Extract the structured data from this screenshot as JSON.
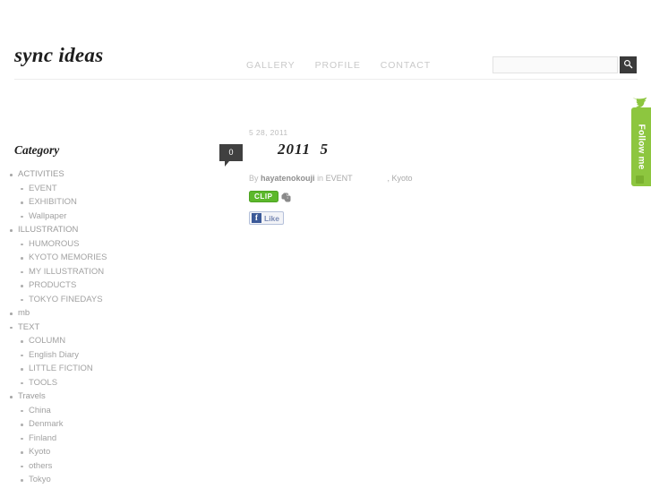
{
  "site": {
    "logo": "sync ideas"
  },
  "nav": {
    "items": [
      {
        "label": "GALLERY"
      },
      {
        "label": "PROFILE"
      },
      {
        "label": "CONTACT"
      }
    ]
  },
  "search": {
    "value": "",
    "placeholder": "",
    "icon": "search-icon"
  },
  "sidebar": {
    "title": "Category",
    "items": [
      {
        "label": "ACTIVITIES",
        "children": [
          {
            "label": "EVENT"
          },
          {
            "label": "EXHIBITION"
          },
          {
            "label": "Wallpaper"
          }
        ]
      },
      {
        "label": "ILLUSTRATION",
        "children": [
          {
            "label": "HUMOROUS"
          },
          {
            "label": "KYOTO MEMORIES"
          },
          {
            "label": "MY ILLUSTRATION"
          },
          {
            "label": "PRODUCTS"
          },
          {
            "label": "TOKYO FINEDAYS"
          }
        ]
      },
      {
        "label": "mb",
        "children": []
      },
      {
        "label": "TEXT",
        "children": [
          {
            "label": "COLUMN"
          },
          {
            "label": "English Diary"
          },
          {
            "label": "LITTLE FICTION"
          },
          {
            "label": "TOOLS"
          }
        ]
      },
      {
        "label": "Travels",
        "children": [
          {
            "label": "China"
          },
          {
            "label": "Denmark"
          },
          {
            "label": "Finland"
          },
          {
            "label": "Kyoto"
          },
          {
            "label": "others"
          },
          {
            "label": "Tokyo"
          }
        ]
      }
    ]
  },
  "post": {
    "date": "5  28, 2011",
    "comment_count": "0",
    "title": "2011  5",
    "meta_by": "By",
    "author": "hayatenokouji",
    "meta_in": "in",
    "category_primary": "EVENT",
    "category_secondary": ", Kyoto",
    "clip_label": "CLIP",
    "evernote_icon": "evernote-elephant-icon",
    "facebook_icon": "facebook-f-icon",
    "like_label": "Like"
  },
  "follow": {
    "label": "Follow me",
    "bird_icon": "twitter-bird-icon",
    "color": "#8dc63f"
  },
  "colors": {
    "accent_green": "#5cb82b",
    "follow_green": "#8dc63f",
    "facebook_blue": "#3b5998",
    "bubble_dark": "#404040",
    "text_gray": "#9b9b9b"
  }
}
